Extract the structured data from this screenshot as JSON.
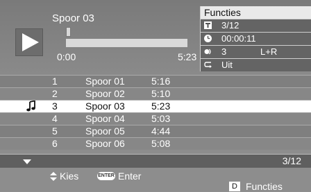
{
  "player": {
    "track_title": "Spoor 03",
    "time_elapsed": "0:00",
    "time_total": "5:23",
    "progress": 0.0
  },
  "functions": {
    "header": "Functies",
    "rows": [
      {
        "icon": "track-icon",
        "value": "3/12",
        "value2": ""
      },
      {
        "icon": "clock-icon",
        "value": "00:00:11",
        "value2": ""
      },
      {
        "icon": "audio-icon",
        "value": "3",
        "value2": "L+R"
      },
      {
        "icon": "repeat-icon",
        "value": "Uit",
        "value2": ""
      }
    ]
  },
  "tracks": [
    {
      "num": "1",
      "name": "Spoor 01",
      "duration": "5:16",
      "selected": false
    },
    {
      "num": "2",
      "name": "Spoor 02",
      "duration": "5:10",
      "selected": false
    },
    {
      "num": "3",
      "name": "Spoor 03",
      "duration": "5:23",
      "selected": true
    },
    {
      "num": "4",
      "name": "Spoor 04",
      "duration": "5:03",
      "selected": false
    },
    {
      "num": "5",
      "name": "Spoor 05",
      "duration": "4:44",
      "selected": false
    },
    {
      "num": "6",
      "name": "Spoor 06",
      "duration": "5:08",
      "selected": false
    }
  ],
  "pager": {
    "indicator": "3/12"
  },
  "help": {
    "select_label": "Kies",
    "enter_key": "ENTER",
    "enter_label": "Enter",
    "func_key": "D",
    "func_label": "Functies"
  }
}
